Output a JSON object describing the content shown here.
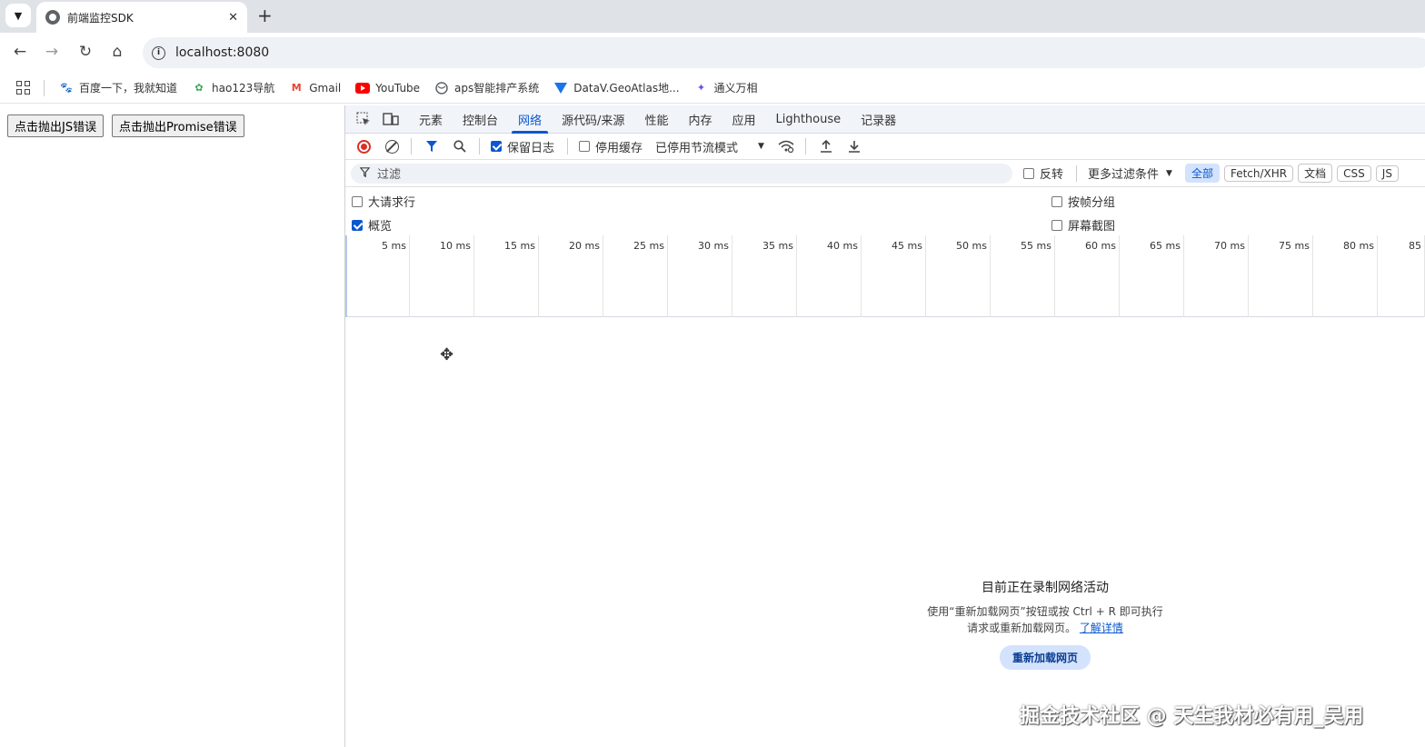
{
  "browser": {
    "tab_title": "前端监控SDK",
    "tab_close": "✕",
    "new_tab": "+",
    "url": "localhost:8080"
  },
  "bookmarks": [
    {
      "label": "百度一下，我就知道",
      "icon": "paw-icon",
      "color": "#2932e1"
    },
    {
      "label": "hao123导航",
      "icon": "hao123-icon",
      "color": "#3aa757"
    },
    {
      "label": "Gmail",
      "icon": "gmail-icon",
      "color": "#ea4335"
    },
    {
      "label": "YouTube",
      "icon": "youtube-icon",
      "color": "#ff0000"
    },
    {
      "label": "aps智能排产系统",
      "icon": "globe-icon",
      "color": "#5f6368"
    },
    {
      "label": "DataV.GeoAtlas地...",
      "icon": "datav-icon",
      "color": "#1a73e8"
    },
    {
      "label": "通义万相",
      "icon": "tongyi-icon",
      "color": "#6b4ce6"
    }
  ],
  "page": {
    "btn_js_error": "点击抛出JS错误",
    "btn_promise_error": "点击抛出Promise错误"
  },
  "devtools": {
    "tabs": [
      "元素",
      "控制台",
      "网络",
      "源代码/来源",
      "性能",
      "内存",
      "应用",
      "Lighthouse",
      "记录器"
    ],
    "active_tab": "网络",
    "toolbar": {
      "preserve_log": "保留日志",
      "disable_cache": "停用缓存",
      "throttling": "已停用节流模式"
    },
    "filter": {
      "placeholder": "过滤",
      "invert": "反转",
      "more_filters": "更多过滤条件",
      "chips": [
        "全部",
        "Fetch/XHR",
        "文档",
        "CSS",
        "JS"
      ]
    },
    "options": {
      "big_rows": "大请求行",
      "overview": "概览",
      "group_by_frame": "按帧分组",
      "screenshots": "屏幕截图"
    },
    "timeline_ticks": [
      "5 ms",
      "10 ms",
      "15 ms",
      "20 ms",
      "25 ms",
      "30 ms",
      "35 ms",
      "40 ms",
      "45 ms",
      "50 ms",
      "55 ms",
      "60 ms",
      "65 ms",
      "70 ms",
      "75 ms",
      "80 ms",
      "85"
    ],
    "empty_state": {
      "title": "目前正在录制网络活动",
      "line1": "使用“重新加载网页”按钮或按 Ctrl + R 即可执行",
      "line2": "请求或重新加载网页。",
      "link": "了解详情",
      "button": "重新加载网页"
    }
  },
  "watermark": "掘金技术社区 @ 天生我材必有用_吴用",
  "colors": {
    "accent": "#0b57d0",
    "record": "#d93025",
    "chip_active_bg": "#d3e3fd"
  }
}
